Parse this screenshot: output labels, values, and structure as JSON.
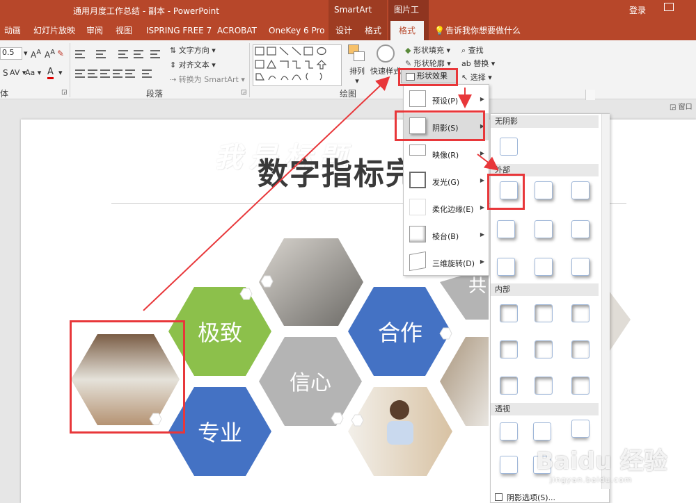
{
  "titlebar": {
    "doc_title": "通用月度工作总结 - 副本  -  PowerPoint",
    "smartart_tools": "SmartArt 工具",
    "picture_tools": "图片工具",
    "login": "登录"
  },
  "tabs": {
    "items": [
      "动画",
      "幻灯片放映",
      "审阅",
      "视图",
      "ISPRING FREE 7",
      "ACROBAT",
      "OneKey 6 Pro",
      "设计",
      "格式",
      "格式"
    ],
    "tell_me": "告诉我你想要做什么"
  },
  "ribbon": {
    "font_size": "0.5",
    "para_cmds": [
      "文字方向",
      "对齐文本",
      "转换为 SmartArt"
    ],
    "font_group": "体",
    "para_group": "段落",
    "draw_group": "绘图",
    "arrange": "排列",
    "quick_styles": "快速样式",
    "shape_fill": "形状填充",
    "shape_outline": "形状轮廓",
    "shape_effects": "形状效果",
    "find": "查找",
    "replace": "替换",
    "select": "选择",
    "pane": "窗口"
  },
  "slide": {
    "title": "数字指标完",
    "watermark": "我是标题",
    "hex_labels": [
      "极致",
      "合作",
      "信心",
      "专业",
      "共"
    ]
  },
  "effects_menu": {
    "items": [
      {
        "label": "预设(P)"
      },
      {
        "label": "阴影(S)"
      },
      {
        "label": "映像(R)"
      },
      {
        "label": "发光(G)"
      },
      {
        "label": "柔化边缘(E)"
      },
      {
        "label": "棱台(B)"
      },
      {
        "label": "三维旋转(D)"
      }
    ]
  },
  "shadow_gallery": {
    "no_shadow": "无阴影",
    "outer": "外部",
    "inner": "内部",
    "perspective": "透视",
    "options": "阴影选项(S)..."
  },
  "watermark_site": {
    "brand": "Baidu 经验",
    "url": "jingyan.baidu.com"
  },
  "colors": {
    "accent": "#b7472a",
    "green": "#8cc04b",
    "blue": "#4472c4",
    "gray": "#b4b4b4",
    "annotation": "#e8373a"
  }
}
